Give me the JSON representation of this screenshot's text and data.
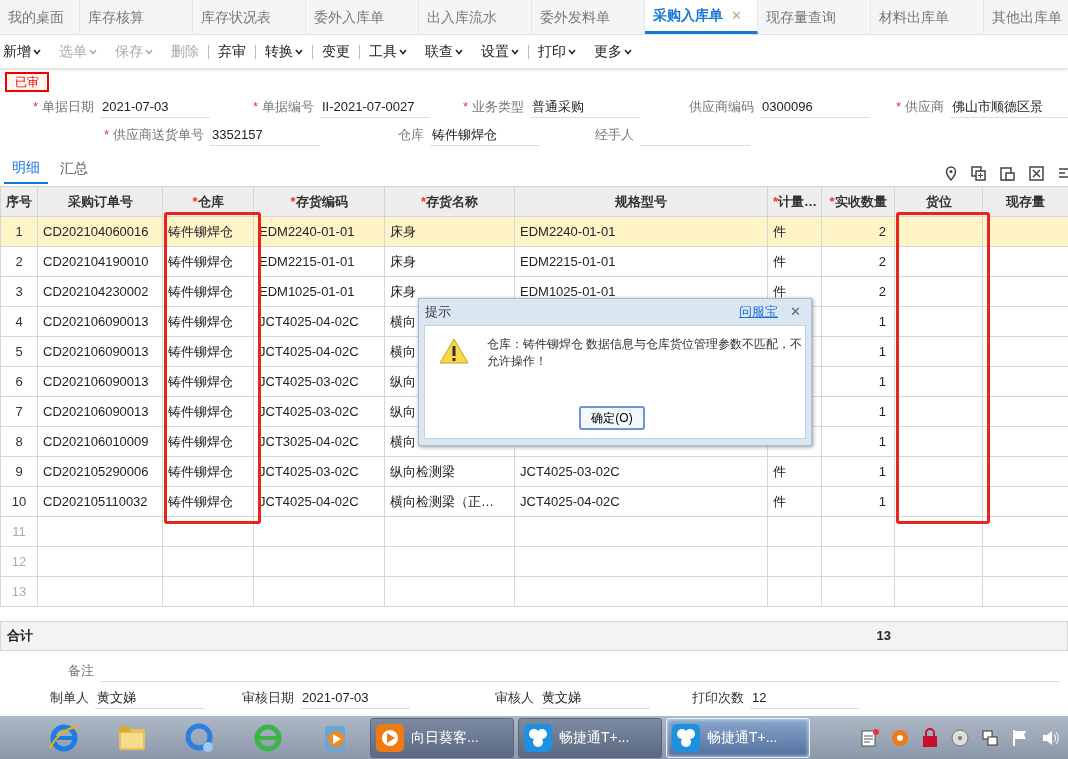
{
  "tabs": [
    {
      "label": "我的桌面",
      "selected": false
    },
    {
      "label": "库存核算",
      "selected": false
    },
    {
      "label": "库存状况表",
      "selected": false
    },
    {
      "label": "委外入库单",
      "selected": false
    },
    {
      "label": "出入库流水",
      "selected": false
    },
    {
      "label": "委外发料单",
      "selected": false
    },
    {
      "label": "采购入库单",
      "selected": true,
      "close": "✕"
    },
    {
      "label": "现存量查询",
      "selected": false
    },
    {
      "label": "材料出库单",
      "selected": false
    },
    {
      "label": "其他出库单",
      "selected": false
    }
  ],
  "toolbar": [
    {
      "kind": "button",
      "label": "新增",
      "dropdown": true,
      "disabled": false
    },
    {
      "kind": "button",
      "label": "选单",
      "dropdown": true,
      "disabled": true
    },
    {
      "kind": "button",
      "label": "保存",
      "dropdown": true,
      "disabled": true
    },
    {
      "kind": "button",
      "label": "删除",
      "dropdown": false,
      "disabled": true
    },
    {
      "kind": "separator"
    },
    {
      "kind": "button",
      "label": "弃审",
      "dropdown": false,
      "disabled": false
    },
    {
      "kind": "separator"
    },
    {
      "kind": "button",
      "label": "转换",
      "dropdown": true,
      "disabled": false
    },
    {
      "kind": "separator"
    },
    {
      "kind": "button",
      "label": "变更",
      "dropdown": false,
      "disabled": false
    },
    {
      "kind": "separator"
    },
    {
      "kind": "button",
      "label": "工具",
      "dropdown": true,
      "disabled": false
    },
    {
      "kind": "button",
      "label": "联查",
      "dropdown": true,
      "disabled": false
    },
    {
      "kind": "button",
      "label": "设置",
      "dropdown": true,
      "disabled": false
    },
    {
      "kind": "separator"
    },
    {
      "kind": "button",
      "label": "打印",
      "dropdown": true,
      "disabled": false
    },
    {
      "kind": "button",
      "label": "更多",
      "dropdown": true,
      "disabled": false
    }
  ],
  "status_badge": "已审",
  "form_rows": [
    [
      {
        "label": "单据日期",
        "required_mark": "*",
        "value": "2021-07-03"
      },
      {
        "label": "单据编号",
        "required_mark": "*",
        "value": "II-2021-07-0027"
      },
      {
        "label": "业务类型",
        "required_mark": "*",
        "value": "普通采购"
      },
      {
        "label": "供应商编码",
        "value": "0300096"
      },
      {
        "label": "供应商",
        "required_mark": "*",
        "value": "佛山市顺德区景"
      }
    ],
    [
      {
        "label": "供应商送货单号",
        "required_mark": "*",
        "value": "3352157"
      },
      {
        "label": "仓库",
        "value": "铸件铆焊仓"
      },
      {
        "label": "经手人"
      }
    ]
  ],
  "sub_tabs": [
    {
      "label": "明细",
      "selected": true
    },
    {
      "label": "汇总",
      "selected": false
    }
  ],
  "table": {
    "columns": [
      {
        "label": "序号",
        "highlighted": false
      },
      {
        "label": "采购订单号",
        "highlighted": false
      },
      {
        "label": "仓库",
        "required_mark": "*",
        "highlighted": true
      },
      {
        "label": "存货编码",
        "required_mark": "*",
        "highlighted": false
      },
      {
        "label": "存货名称",
        "required_mark": "*",
        "highlighted": false
      },
      {
        "label": "规格型号",
        "highlighted": false
      },
      {
        "label": "计量…",
        "required_mark": "*",
        "highlighted": false
      },
      {
        "label": "实收数量",
        "required_mark": "*",
        "highlighted": false
      },
      {
        "label": "货位",
        "highlighted": true
      },
      {
        "label": "现存量",
        "highlighted": false
      }
    ],
    "rows": [
      {
        "cells": [
          "1",
          "CD202104060016",
          "铸件铆焊仓",
          "EDM2240-01-01",
          "床身",
          "EDM2240-01-01",
          "件",
          "2"
        ],
        "selected": true
      },
      {
        "cells": [
          "2",
          "CD202104190010",
          "铸件铆焊仓",
          "EDM2215-01-01",
          "床身",
          "EDM2215-01-01",
          "件",
          "2"
        ],
        "selected": false
      },
      {
        "cells": [
          "3",
          "CD202104230002",
          "铸件铆焊仓",
          "EDM1025-01-01",
          "床身",
          "EDM1025-01-01",
          "件",
          "2"
        ],
        "selected": false
      },
      {
        "cells": [
          "4",
          "CD202106090013",
          "铸件铆焊仓",
          "JCT4025-04-02C",
          "横向",
          null,
          null,
          "1"
        ],
        "selected": false
      },
      {
        "cells": [
          "5",
          "CD202106090013",
          "铸件铆焊仓",
          "JCT4025-04-02C",
          "横向",
          null,
          null,
          "1"
        ],
        "selected": false
      },
      {
        "cells": [
          "6",
          "CD202106090013",
          "铸件铆焊仓",
          "JCT4025-03-02C",
          "纵向",
          null,
          null,
          "1"
        ],
        "selected": false
      },
      {
        "cells": [
          "7",
          "CD202106090013",
          "铸件铆焊仓",
          "JCT4025-03-02C",
          "纵向",
          null,
          null,
          "1"
        ],
        "selected": false
      },
      {
        "cells": [
          "8",
          "CD202106010009",
          "铸件铆焊仓",
          "JCT3025-04-02C",
          "横向",
          null,
          null,
          "1"
        ],
        "selected": false
      },
      {
        "cells": [
          "9",
          "CD202105290006",
          "铸件铆焊仓",
          "JCT4025-03-02C",
          "纵向检测梁",
          "JCT4025-03-02C",
          "件",
          "1"
        ],
        "selected": false
      },
      {
        "cells": [
          "10",
          "CD202105110032",
          "铸件铆焊仓",
          "JCT4025-04-02C",
          "横向检测梁（正…",
          "JCT4025-04-02C",
          "件",
          "1"
        ],
        "selected": false
      },
      {
        "cells": [
          "11"
        ],
        "selected": false
      },
      {
        "cells": [
          "12"
        ],
        "selected": false
      },
      {
        "cells": [
          "13"
        ],
        "selected": false
      }
    ],
    "total": {
      "label": "合计",
      "qty": "13"
    }
  },
  "dialog": {
    "title": "提示",
    "help_link": "问服宝",
    "close": "✕",
    "message": "仓库：铸件铆焊仓 数据信息与仓库货位管理参数不匹配，不允许操作！",
    "ok": "确定(O)"
  },
  "remark": {
    "label": "备注"
  },
  "footer": [
    {
      "label": "制单人",
      "value": "黄文娣"
    },
    {
      "label": "审核日期",
      "value": "2021-07-03"
    },
    {
      "label": "审核人",
      "value": "黄文娣"
    },
    {
      "label": "打印次数",
      "value": "12"
    }
  ],
  "taskbar": {
    "windows": [
      {
        "label": "向日葵客...",
        "kind": "sunflower",
        "selected": false
      },
      {
        "label": "畅捷通T+...",
        "kind": "clover",
        "selected": false
      },
      {
        "label": "畅捷通T+...",
        "kind": "clover",
        "selected": true
      }
    ]
  }
}
